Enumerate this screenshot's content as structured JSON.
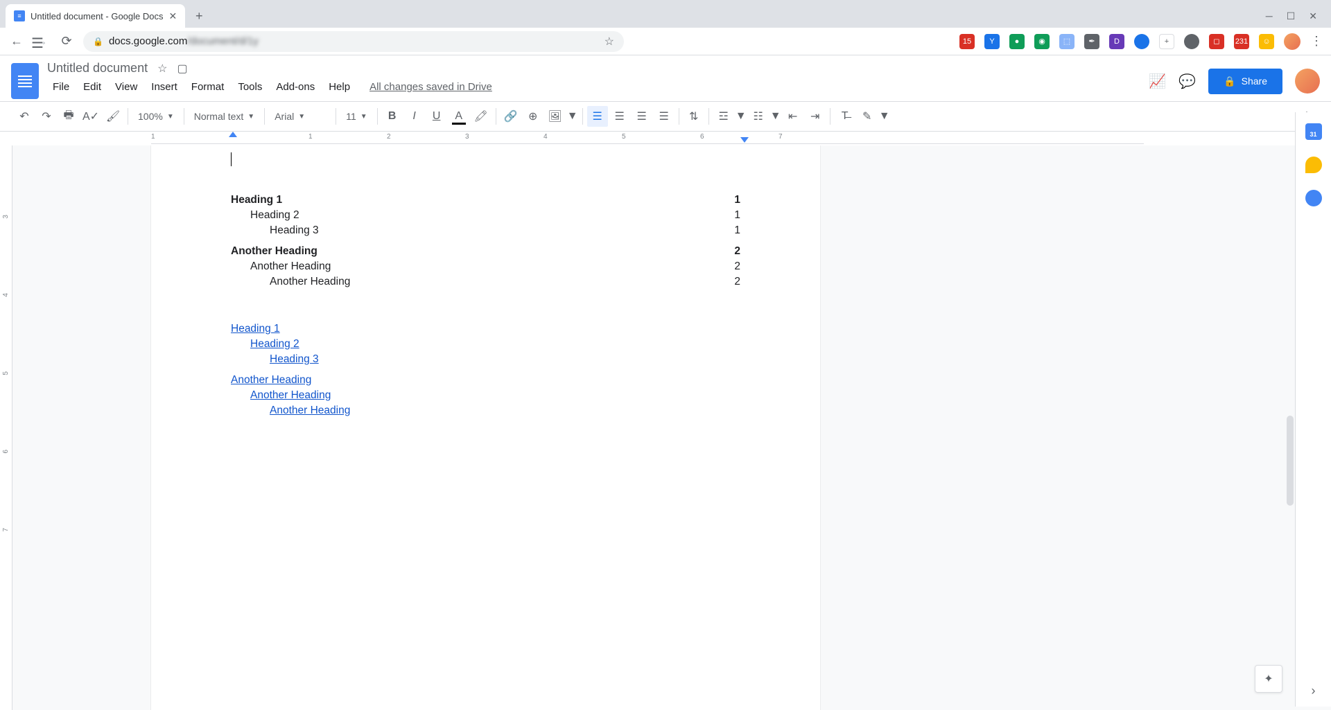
{
  "browser": {
    "tab_title": "Untitled document - Google Docs",
    "url_domain": "docs.google.com",
    "url_path": "/document/d/1y"
  },
  "header": {
    "doc_title": "Untitled document",
    "share_label": "Share",
    "save_status": "All changes saved in Drive"
  },
  "menus": [
    "File",
    "Edit",
    "View",
    "Insert",
    "Format",
    "Tools",
    "Add-ons",
    "Help"
  ],
  "toolbar": {
    "zoom": "100%",
    "style": "Normal text",
    "font": "Arial",
    "size": "11"
  },
  "ruler_ticks": [
    "1",
    "1",
    "2",
    "3",
    "4",
    "5",
    "6",
    "7"
  ],
  "left_ruler_ticks": [
    "3",
    "4",
    "5",
    "6",
    "7"
  ],
  "toc_numbered": [
    {
      "items": [
        {
          "level": 1,
          "text": "Heading 1",
          "page": "1"
        },
        {
          "level": 2,
          "text": "Heading 2",
          "page": "1"
        },
        {
          "level": 3,
          "text": "Heading 3",
          "page": "1"
        }
      ]
    },
    {
      "items": [
        {
          "level": 1,
          "text": "Another Heading",
          "page": "2"
        },
        {
          "level": 2,
          "text": "Another Heading",
          "page": "2"
        },
        {
          "level": 3,
          "text": "Another Heading",
          "page": "2"
        }
      ]
    }
  ],
  "toc_linked": [
    {
      "items": [
        {
          "level": 1,
          "text": "Heading 1"
        },
        {
          "level": 2,
          "text": "Heading 2"
        },
        {
          "level": 3,
          "text": "Heading 3"
        }
      ]
    },
    {
      "items": [
        {
          "level": 1,
          "text": "Another Heading"
        },
        {
          "level": 2,
          "text": "Another Heading"
        },
        {
          "level": 3,
          "text": "Another Heading"
        }
      ]
    }
  ]
}
